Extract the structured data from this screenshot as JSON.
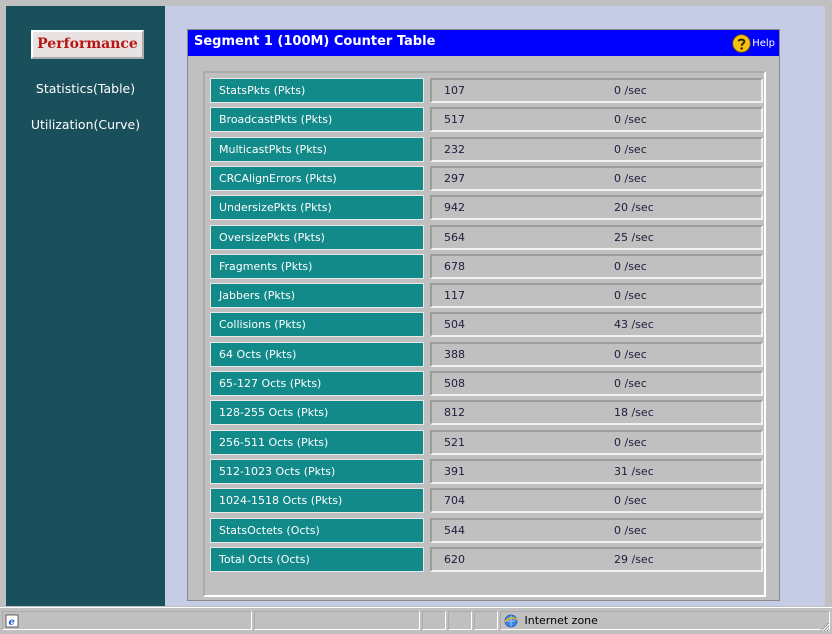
{
  "sidebar": {
    "active_item": "Performance",
    "items": [
      {
        "label": "Statistics(Table)"
      },
      {
        "label": "Utilization(Curve)"
      }
    ]
  },
  "panel": {
    "title": "Segment 1 (100M) Counter Table",
    "help_label": "Help"
  },
  "table": {
    "rows": [
      {
        "name": "StatsPkts (Pkts)",
        "count": "107",
        "rate": "0 /sec"
      },
      {
        "name": "BroadcastPkts (Pkts)",
        "count": "517",
        "rate": "0 /sec"
      },
      {
        "name": "MulticastPkts (Pkts)",
        "count": "232",
        "rate": "0 /sec"
      },
      {
        "name": "CRCAlignErrors (Pkts)",
        "count": "297",
        "rate": "0 /sec"
      },
      {
        "name": "UndersizePkts (Pkts)",
        "count": "942",
        "rate": "20 /sec"
      },
      {
        "name": "OversizePkts (Pkts)",
        "count": "564",
        "rate": "25 /sec"
      },
      {
        "name": "Fragments (Pkts)",
        "count": "678",
        "rate": "0 /sec"
      },
      {
        "name": "Jabbers (Pkts)",
        "count": "117",
        "rate": "0 /sec"
      },
      {
        "name": "Collisions (Pkts)",
        "count": "504",
        "rate": "43 /sec"
      },
      {
        "name": "64 Octs (Pkts)",
        "count": "388",
        "rate": "0 /sec"
      },
      {
        "name": "65-127 Octs (Pkts)",
        "count": "508",
        "rate": "0 /sec"
      },
      {
        "name": "128-255 Octs (Pkts)",
        "count": "812",
        "rate": "18 /sec"
      },
      {
        "name": "256-511 Octs (Pkts)",
        "count": "521",
        "rate": "0 /sec"
      },
      {
        "name": "512-1023 Octs (Pkts)",
        "count": "391",
        "rate": "31 /sec"
      },
      {
        "name": "1024-1518 Octs (Pkts)",
        "count": "704",
        "rate": "0 /sec"
      },
      {
        "name": "StatsOctets (Octs)",
        "count": "544",
        "rate": "0 /sec"
      },
      {
        "name": "Total Octs (Octs)",
        "count": "620",
        "rate": "29 /sec"
      }
    ]
  },
  "statusbar": {
    "zone": "Internet zone",
    "zone_icon": "ie-globe-icon",
    "page_icon": "ie-page-icon"
  },
  "colors": {
    "sidebar_bg": "#1a4f5c",
    "active_text": "#b81414",
    "content_bg": "#c6cce6",
    "titlebar": "#0000ff",
    "label_cell": "#138a8a"
  }
}
